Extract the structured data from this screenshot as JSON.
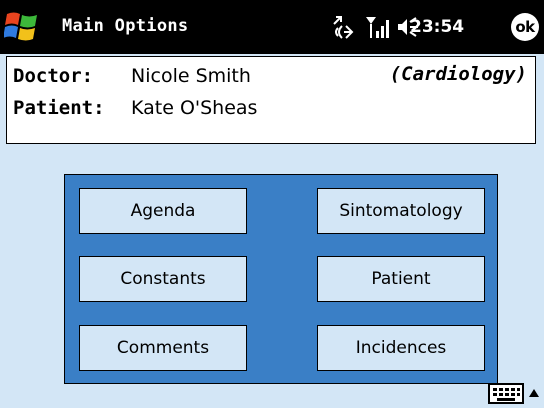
{
  "titlebar": {
    "title": "Main Options",
    "clock": "23:54",
    "ok_label": "ok",
    "icons": [
      "windows-start-icon",
      "connectivity-icon",
      "signal-icon",
      "volume-icon"
    ]
  },
  "info": {
    "doctor_label": "Doctor:",
    "doctor_name": "Nicole Smith",
    "specialty": "(Cardiology)",
    "patient_label": "Patient:",
    "patient_name": "Kate O'Sheas"
  },
  "menu": {
    "agenda": "Agenda",
    "sintomatology": "Sintomatology",
    "constants": "Constants",
    "patient": "Patient",
    "comments": "Comments",
    "incidences": "Incidences"
  },
  "colors": {
    "background": "#d3e6f6",
    "menu_panel": "#3a7fc6",
    "titlebar": "#000000"
  }
}
